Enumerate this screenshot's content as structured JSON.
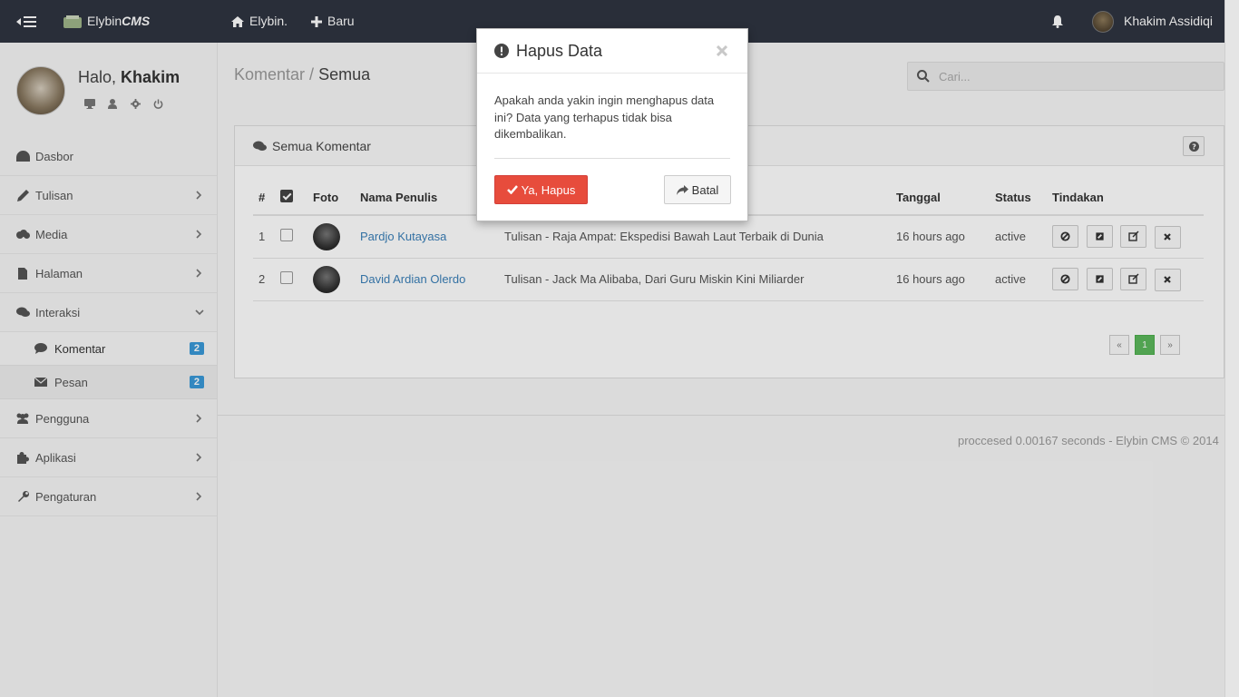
{
  "topbar": {
    "brand_prefix": "Elybin",
    "brand_suffix": "CMS",
    "home_label": "Elybin.",
    "new_label": "Baru",
    "user_name": "Khakim Assidiqi"
  },
  "sidebar": {
    "greeting_prefix": "Halo,",
    "greeting_name": "Khakim",
    "items": [
      {
        "label": "Dasbor",
        "icon": "dashboard-icon"
      },
      {
        "label": "Tulisan",
        "icon": "pencil-icon"
      },
      {
        "label": "Media",
        "icon": "cloud-icon"
      },
      {
        "label": "Halaman",
        "icon": "file-icon"
      },
      {
        "label": "Interaksi",
        "icon": "comments-icon"
      },
      {
        "label": "Pengguna",
        "icon": "users-icon"
      },
      {
        "label": "Aplikasi",
        "icon": "puzzle-icon"
      },
      {
        "label": "Pengaturan",
        "icon": "wrench-icon"
      }
    ],
    "sub_items": [
      {
        "label": "Komentar",
        "badge": "2",
        "icon": "comment-icon"
      },
      {
        "label": "Pesan",
        "badge": "2",
        "icon": "envelope-icon"
      }
    ]
  },
  "main": {
    "breadcrumb_parent": "Komentar",
    "breadcrumb_sep": " / ",
    "breadcrumb_current": "Semua",
    "search_placeholder": "Cari...",
    "panel_title": "Semua Komentar",
    "columns": [
      "#",
      "",
      "Foto",
      "Nama Penulis",
      "",
      "Tanggal",
      "Status",
      "Tindakan"
    ],
    "rows": [
      {
        "num": "1",
        "author": "Pardjo Kutayasa",
        "post": "Tulisan - Raja Ampat: Ekspedisi Bawah Laut Terbaik di Dunia",
        "date": "16 hours ago",
        "status": "active"
      },
      {
        "num": "2",
        "author": "David Ardian Olerdo",
        "post": "Tulisan - Jack Ma Alibaba, Dari Guru Miskin Kini Miliarder",
        "date": "16 hours ago",
        "status": "active"
      }
    ],
    "pager": {
      "prev": "«",
      "current": "1",
      "next": "»"
    },
    "footer": "proccesed 0.00167 seconds - Elybin CMS © 2014"
  },
  "modal": {
    "title": "Hapus Data",
    "body": "Apakah anda yakin ingin menghapus data ini? Data yang terhapus tidak bisa dikembalikan.",
    "confirm_label": "Ya, Hapus",
    "cancel_label": "Batal"
  },
  "colors": {
    "topbar": "#2f3440",
    "danger": "#e74c3c",
    "link": "#3a7fb8",
    "badge": "#3a99d8",
    "pager_active": "#5cb85c"
  }
}
